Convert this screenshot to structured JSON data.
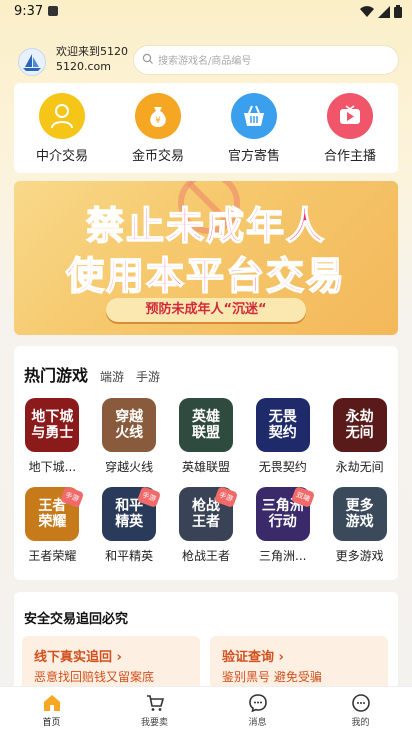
{
  "status": {
    "time": "9:37"
  },
  "header": {
    "welcome_line1": "欢迎来到5120",
    "welcome_line2": "5120.com",
    "search_placeholder": "搜索游戏名/商品编号"
  },
  "services": [
    {
      "label": "中介交易",
      "icon": "agent-person-icon",
      "color": "#f5c518"
    },
    {
      "label": "金币交易",
      "icon": "money-bag-icon",
      "color": "#f5a623"
    },
    {
      "label": "官方寄售",
      "icon": "shopping-basket-icon",
      "color": "#3aa0ee"
    },
    {
      "label": "合作主播",
      "icon": "video-play-icon",
      "color": "#f0556a"
    }
  ],
  "banner": {
    "line1": "禁止未成年人",
    "line2": "使用本平台交易",
    "ribbon": "预防未成年人“沉迷“"
  },
  "games": {
    "title": "热门游戏",
    "tabs": [
      "端游",
      "手游"
    ],
    "items": [
      {
        "icon_text": "地下城\n与勇士",
        "label": "地下城...",
        "color": "#8b1b1b",
        "tag": ""
      },
      {
        "icon_text": "穿越\n火线",
        "label": "穿越火线",
        "color": "#8a5a3c",
        "tag": ""
      },
      {
        "icon_text": "英雄\n联盟",
        "label": "英雄联盟",
        "color": "#2f4a3e",
        "tag": ""
      },
      {
        "icon_text": "无畏\n契约",
        "label": "无畏契约",
        "color": "#1f2a6b",
        "tag": ""
      },
      {
        "icon_text": "永劫\n无间",
        "label": "永劫无间",
        "color": "#5a1a1a",
        "tag": ""
      },
      {
        "icon_text": "王者\n荣耀",
        "label": "王者荣耀",
        "color": "#c77a1a",
        "tag": "手游"
      },
      {
        "icon_text": "和平\n精英",
        "label": "和平精英",
        "color": "#2a3a5a",
        "tag": "手游"
      },
      {
        "icon_text": "枪战\n王者",
        "label": "枪战王者",
        "color": "#3a4256",
        "tag": "手游"
      },
      {
        "icon_text": "三角洲\n行动",
        "label": "三角洲...",
        "color": "#3a2a6a",
        "tag": "双端"
      },
      {
        "icon_text": "更多\n游戏",
        "label": "更多游戏",
        "color": "#3a4a5a",
        "tag": ""
      }
    ]
  },
  "safe": {
    "title": "安全交易追回必究",
    "cards": [
      {
        "title": "线下真实追回 ›",
        "sub": "恶意找回赔钱又留案底"
      },
      {
        "title": "验证查询 ›",
        "sub": "鉴别黑号 避免受骗"
      }
    ]
  },
  "tabbar": [
    {
      "label": "首页",
      "icon": "home-icon",
      "active": true
    },
    {
      "label": "我要卖",
      "icon": "cart-icon",
      "active": false
    },
    {
      "label": "消息",
      "icon": "message-icon",
      "active": false
    },
    {
      "label": "我的",
      "icon": "profile-icon",
      "active": false
    }
  ]
}
